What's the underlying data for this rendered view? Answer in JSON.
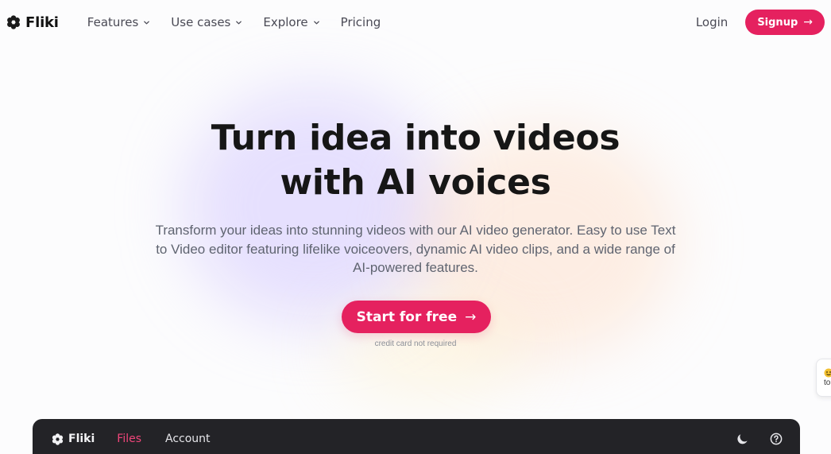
{
  "brand": {
    "name": "Fliki",
    "icon": "flower-gear-icon"
  },
  "nav": {
    "links": [
      {
        "label": "Features",
        "has_dropdown": true
      },
      {
        "label": "Use cases",
        "has_dropdown": true
      },
      {
        "label": "Explore",
        "has_dropdown": true
      },
      {
        "label": "Pricing",
        "has_dropdown": false
      }
    ],
    "login_label": "Login",
    "signup_label": "Signup",
    "signup_arrow": "→"
  },
  "hero": {
    "title_line1": "Turn idea into videos",
    "title_line2": "with AI voices",
    "subtitle": "Transform your ideas into stunning videos with our AI video generator. Easy to use Text to Video editor featuring lifelike voiceovers, dynamic AI video clips, and a wide range of AI-powered features.",
    "cta_label": "Start for free",
    "cta_arrow": "→",
    "credit_note": "credit card not required"
  },
  "side_widget": {
    "text": "to",
    "icon": "emoji-icon"
  },
  "app_preview": {
    "brand_name": "Fliki",
    "tabs": [
      {
        "label": "Files",
        "active": true
      },
      {
        "label": "Account",
        "active": false
      }
    ],
    "icons": [
      "moon-icon",
      "help-circle-icon"
    ]
  },
  "colors": {
    "accent": "#e5215f",
    "app_bar": "#232327",
    "active_tab": "#f0457a",
    "text_dark": "#161616",
    "text_muted": "#5f6470"
  }
}
